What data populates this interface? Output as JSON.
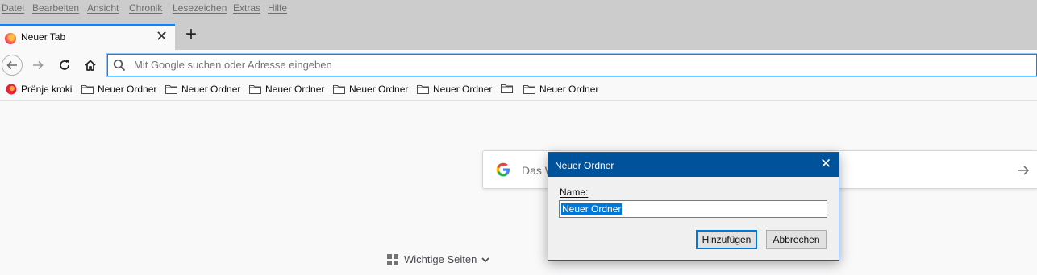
{
  "menubar": {
    "items": [
      "Datei",
      "Bearbeiten",
      "Ansicht",
      "Chronik",
      "Lesezeichen",
      "Extras",
      "Hilfe"
    ]
  },
  "tab": {
    "title": "Neuer Tab",
    "close": "✕"
  },
  "newtab": {
    "label": "+"
  },
  "urlbar": {
    "placeholder": "Mit Google suchen oder Adresse eingeben"
  },
  "bookmarks": {
    "items": [
      "Prënje kroki",
      "Neuer Ordner",
      "Neuer Ordner",
      "Neuer Ordner",
      "Neuer Ordner",
      "Neuer Ordner",
      "",
      "Neuer Ordner"
    ]
  },
  "search": {
    "placeholder": "Das W"
  },
  "topsites": {
    "label": "Wichtige Seiten"
  },
  "dialog": {
    "title": "Neuer Ordner",
    "close": "✕",
    "name_label": "Name:",
    "name_value": "Neuer Ordner",
    "add_button": "Hinzufügen",
    "cancel_button": "Abbrechen"
  },
  "colors": {
    "accent": "#0a84ff",
    "dialog_title": "#00529b",
    "selection": "#0078d7"
  }
}
